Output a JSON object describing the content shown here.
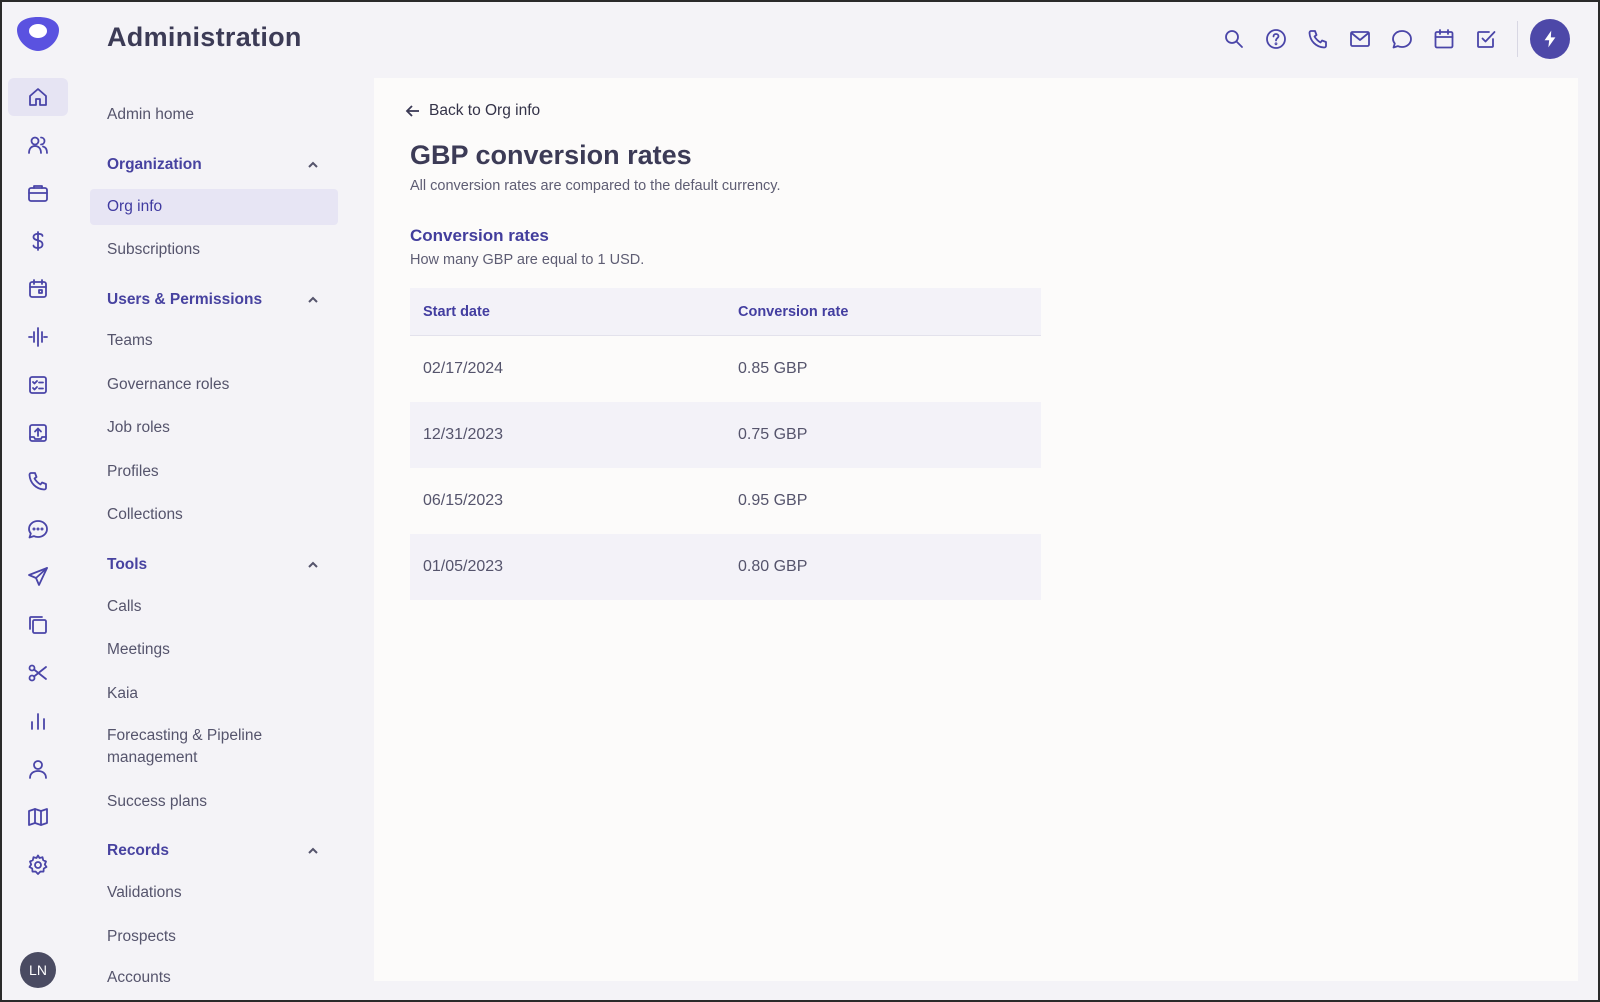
{
  "header": {
    "title": "Administration",
    "toolbar": [
      "search-icon",
      "help-icon",
      "phone-icon",
      "mail-icon",
      "chat-icon",
      "calendar-icon",
      "task-icon",
      "bolt-icon"
    ]
  },
  "rail": {
    "icons": [
      "home-icon",
      "people-icon",
      "briefcase-icon",
      "dollar-icon",
      "calendar-icon",
      "pulse-icon",
      "checklist-icon",
      "upload-icon",
      "phone-icon",
      "chat-icon",
      "send-icon",
      "copy-icon",
      "scissors-icon",
      "bar-chart-icon",
      "person-icon",
      "map-icon",
      "settings-icon"
    ],
    "active": "home-icon",
    "avatar_initials": "LN"
  },
  "subnav": {
    "admin_home": "Admin home",
    "sections": [
      {
        "label": "Organization",
        "items": [
          "Org info",
          "Subscriptions"
        ]
      },
      {
        "label": "Users & Permissions",
        "items": [
          "Teams",
          "Governance roles",
          "Job roles",
          "Profiles",
          "Collections"
        ]
      },
      {
        "label": "Tools",
        "items": [
          "Calls",
          "Meetings",
          "Kaia",
          "Forecasting & Pipeline management",
          "Success plans"
        ]
      },
      {
        "label": "Records",
        "items": [
          "Validations",
          "Prospects",
          "Accounts"
        ]
      }
    ],
    "active_item": "Org info"
  },
  "main": {
    "back_label": "Back to Org info",
    "title": "GBP conversion rates",
    "subtitle": "All conversion rates are compared to the default currency.",
    "section_title": "Conversion rates",
    "section_subtitle": "How many GBP are equal to 1 USD.",
    "table": {
      "headers": [
        "Start date",
        "Conversion rate"
      ],
      "rows": [
        [
          "02/17/2024",
          "0.85 GBP"
        ],
        [
          "12/31/2023",
          "0.75 GBP"
        ],
        [
          "06/15/2023",
          "0.95 GBP"
        ],
        [
          "01/05/2023",
          "0.80 GBP"
        ]
      ]
    }
  },
  "colors": {
    "accent": "#4a45a8",
    "background": "#f4f3f7",
    "card": "#fcfbfa"
  }
}
